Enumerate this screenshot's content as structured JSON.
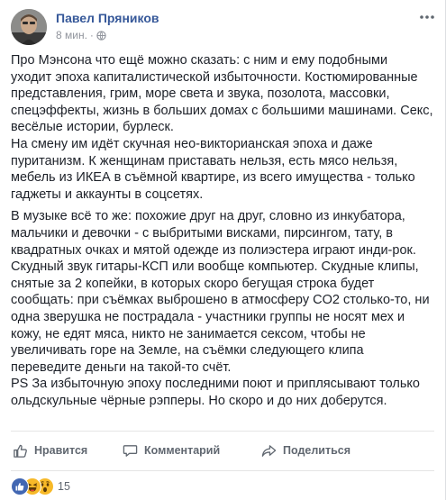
{
  "post": {
    "author": "Павел Пряников",
    "time": "8 мин.",
    "paragraphs": [
      {
        "lines": [
          "Про Мэнсона что ещё можно сказать: с ним и ему подобными",
          "уходит эпоха капиталистической избыточности. Костюмированные",
          "представления, грим, море света и звука, позолота, массовки,",
          "спецэффекты, жизнь в больших домах с большими машинами. Секс,",
          "весёлые истории, бурлеск.",
          "На смену им идёт скучная нео-викторианская эпоха и даже",
          "пуританизм. К женщинам приставать нельзя, есть мясо нельзя,",
          "мебель из ИКЕА в съёмной квартире, из всего имущества - только",
          "гаджеты и аккаунты в соцсетях."
        ]
      },
      {
        "lines": [
          "В музыке всё то же: похожие друг на друг, словно из инкубатора,",
          "мальчики и девочки - с выбритыми висками, пирсингом, тату, в",
          "квадратных очках и мятой одежде из полиэстера играют инди-рок.",
          "Скудный звук гитары-КСП или вообще компьютер. Скудные клипы,",
          "снятые за 2 копейки, в которых скоро бегущая строка будет",
          "сообщать: при съёмках выброшено в атмосферу CO2 столько-то, ни",
          "одна зверушка не пострадала - участники группы не носят мех и",
          "кожу, не едят мяса, никто не занимается сексом, чтобы не",
          "увеличивать горе на Земле, на съёмки следующего клипа",
          "переведите деньги на такой-то счёт.",
          "PS За избыточную эпоху последними поют и приплясывают только",
          "ольдскульные чёрные рэпперы. Но скоро и до них доберутся."
        ]
      }
    ]
  },
  "actions": {
    "like": "Нравится",
    "comment": "Комментарий",
    "share": "Поделиться"
  },
  "reactions": {
    "types": [
      "like-icon",
      "haha-icon",
      "wow-icon"
    ],
    "count": "15"
  },
  "colors": {
    "author": "#365899",
    "text": "#1d2129",
    "meta": "#90949c",
    "action": "#606770",
    "like_blue": "#4267b2",
    "emoji_yellow": "#f7b928"
  }
}
